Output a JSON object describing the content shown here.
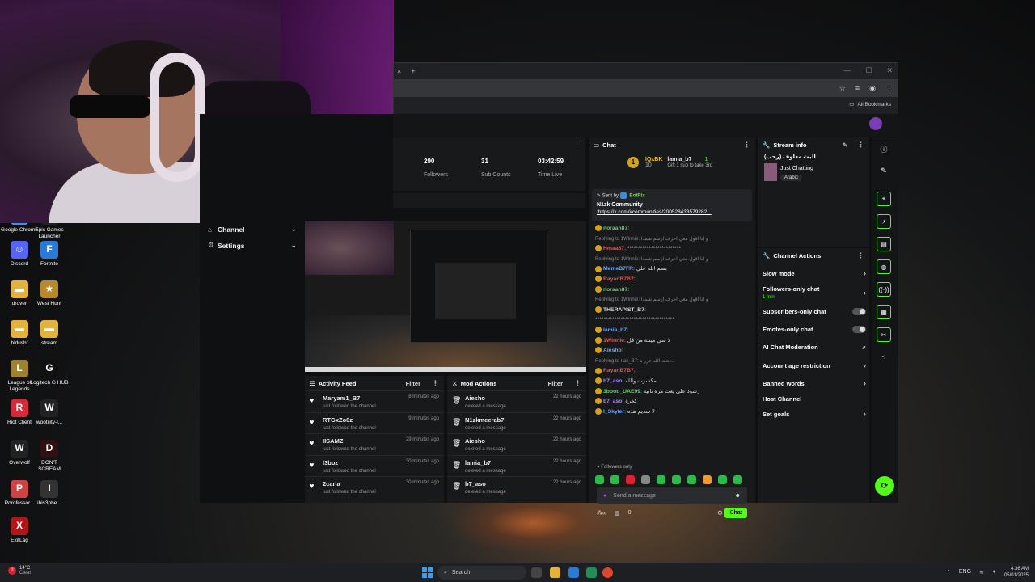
{
  "desktop_icons": [
    {
      "label": "Google Chrome",
      "glyph": "●",
      "color": "#4a8af4"
    },
    {
      "label": "Epic Games Launcher",
      "glyph": "E",
      "color": "#222"
    },
    {
      "label": "Discord",
      "glyph": "☺",
      "color": "#5865f2"
    },
    {
      "label": "Fortnite",
      "glyph": "F",
      "color": "#2a7ad8"
    },
    {
      "label": "drover",
      "glyph": "▬",
      "color": "#e2b23a"
    },
    {
      "label": "West Hunt",
      "glyph": "★",
      "color": "#b8892a"
    },
    {
      "label": "hidusbf",
      "glyph": "▬",
      "color": "#e2b23a"
    },
    {
      "label": "stream",
      "glyph": "▬",
      "color": "#e2b23a"
    },
    {
      "label": "League of Legends",
      "glyph": "L",
      "color": "#a0822e"
    },
    {
      "label": "Logitech G HUB",
      "glyph": "G",
      "color": "#111"
    },
    {
      "label": "Riot Client",
      "glyph": "R",
      "color": "#d8283a"
    },
    {
      "label": "wootility-l...",
      "glyph": "W",
      "color": "#222"
    },
    {
      "label": "Overwolf",
      "glyph": "W",
      "color": "#222"
    },
    {
      "label": "DON'T SCREAM",
      "glyph": "D",
      "color": "#301010"
    },
    {
      "label": "Porofessor...",
      "glyph": "P",
      "color": "#c44"
    },
    {
      "label": "ibis3phe...",
      "glyph": "I",
      "color": "#333"
    },
    {
      "label": "ExitLag",
      "glyph": "X",
      "color": "#b01818"
    }
  ],
  "browser": {
    "close_tab": "×",
    "new_tab": "+",
    "bookmarks_label": "All Bookmarks",
    "window_controls": [
      "—",
      "☐",
      "✕"
    ]
  },
  "stats": [
    {
      "value": "290",
      "label": "Followers"
    },
    {
      "value": "31",
      "label": "Sub Counts"
    },
    {
      "value": "03:42:59",
      "label": "Time Live"
    }
  ],
  "nav": [
    {
      "label": "Channel",
      "icon": "⌂"
    },
    {
      "label": "Settings",
      "icon": "⚙"
    }
  ],
  "activity": {
    "title": "Activity Feed",
    "filter": "Filter",
    "items": [
      {
        "name": "Maryam1_B7",
        "sub": "just followed the channel",
        "time": "8 minutes ago"
      },
      {
        "name": "RTGxZo0z",
        "sub": "just followed the channel",
        "time": "9 minutes ago"
      },
      {
        "name": "IISAMZ",
        "sub": "just followed the channel",
        "time": "29 minutes ago"
      },
      {
        "name": "l3boz",
        "sub": "just followed the channel",
        "time": "30 minutes ago"
      },
      {
        "name": "2carla",
        "sub": "just followed the channel",
        "time": "30 minutes ago"
      }
    ]
  },
  "mod": {
    "title": "Mod Actions",
    "filter": "Filter",
    "items": [
      {
        "name": "Aiesho",
        "sub": "deleted a message",
        "time": "22 hours ago"
      },
      {
        "name": "N1zkmeerab7",
        "sub": "deleted a message",
        "time": "22 hours ago"
      },
      {
        "name": "Aiesho",
        "sub": "deleted a message",
        "time": "22 hours ago"
      },
      {
        "name": "lamia_b7",
        "sub": "deleted a message",
        "time": "22 hours ago"
      },
      {
        "name": "b7_aso",
        "sub": "deleted a message",
        "time": "22 hours ago"
      }
    ]
  },
  "chat": {
    "title": "Chat",
    "top_gifter_count": "1",
    "top_gifter_1": "IQxBK",
    "top_gifter_1_sub": "10",
    "top_gifter_2": "lamia_b7",
    "top_gifter_2_count": "1",
    "gift_promo": "Gift 1 sub to take 3rd",
    "pinned_by_label": "Sent by",
    "pinned_by": "BotRix",
    "pinned_title": "N1zk Community",
    "pinned_link": ":https://x.com/i/communities/200528433579282...",
    "messages": [
      {
        "type": "msg",
        "user": "noraah87",
        "color": "#5fd15f",
        "text": ":"
      },
      {
        "type": "reply",
        "text": "Replying to 1Winnie: و انا اقول معي احرف ازسم شمدا"
      },
      {
        "type": "msg",
        "user": "Hmaa87",
        "color": "#e05555",
        "text": ": *************************"
      },
      {
        "type": "reply",
        "text": "Replying to 1Winnie: و انا اقول معي احرف ازسم شمدا"
      },
      {
        "type": "msg",
        "user": "MemeB7FR",
        "color": "#6aa8ff",
        "text": ": بسم الله علي"
      },
      {
        "type": "msg",
        "user": "RayanB7B7",
        "color": "#e05555",
        "text": ":"
      },
      {
        "type": "msg",
        "user": "noraah87",
        "color": "#5fd15f",
        "text": ":"
      },
      {
        "type": "reply",
        "text": "Replying to 1Winnie: و انا اقول معي احرف ازسم شمدا"
      },
      {
        "type": "msg",
        "user": "THERAPIST_B7",
        "color": "#dddddd",
        "text": ":"
      },
      {
        "type": "plain",
        "text": "*************************************"
      },
      {
        "type": "msg",
        "user": "lamia_b7",
        "color": "#6aa8ff",
        "text": ":"
      },
      {
        "type": "msg",
        "user": "1Winnie",
        "color": "#e05555",
        "text": ": لا سي مينلة من قل"
      },
      {
        "type": "msg",
        "user": "Aiesho",
        "color": "#6aa8ff",
        "text": ":"
      },
      {
        "type": "reply",
        "text": "Replying to rlak_B7: تحت الله عزر ه... "
      },
      {
        "type": "msg",
        "user": "RayanB7B7",
        "color": "#e05555",
        "text": ":"
      },
      {
        "type": "msg",
        "user": "b7_aso",
        "color": "#a78bfa",
        "text": ": مكسرت والله"
      },
      {
        "type": "msg",
        "user": "3bood_UAE99",
        "color": "#5fd15f",
        "text": ": رشود علي يعت مره ثانيه"
      },
      {
        "type": "msg",
        "user": "b7_aso",
        "color": "#a78bfa",
        "text": ": كخرة"
      },
      {
        "type": "msg",
        "user": "l_Skyler",
        "color": "#6aa8ff",
        "text": ": لا سديم هذه"
      }
    ],
    "followers_only": "Followers only",
    "input_placeholder": "Send a message",
    "viewer_count": "0",
    "send_label": "Chat"
  },
  "stream_info": {
    "title": "Stream info",
    "stream_title": "البث معاوف (رحب)",
    "category": "Just Chatting",
    "tag": "Arabic"
  },
  "channel_actions": {
    "title": "Channel Actions",
    "items": [
      {
        "label": "Slow mode",
        "control": "arrow"
      },
      {
        "label": "Followers-only chat",
        "sub": "1 min",
        "control": "arrow"
      },
      {
        "label": "Subscribers-only chat",
        "control": "toggle"
      },
      {
        "label": "Emotes-only chat",
        "control": "toggle"
      },
      {
        "label": "AI Chat Moderation",
        "control": "external"
      },
      {
        "label": "Account age restriction",
        "control": "arrow"
      },
      {
        "label": "Banned words",
        "control": "arrow"
      },
      {
        "label": "Host Channel",
        "control": "none"
      },
      {
        "label": "Set goals",
        "control": "arrow"
      }
    ]
  },
  "taskbar": {
    "weather_temp": "14°C",
    "weather_desc": "Clear",
    "weather_alert": "2",
    "search": "Search",
    "lang": "ENG",
    "time": "4:36 AM",
    "date": "05/01/2025"
  },
  "colors": {
    "accent": "#53fc18",
    "panel": "#18191b",
    "bg": "#0f1011"
  }
}
